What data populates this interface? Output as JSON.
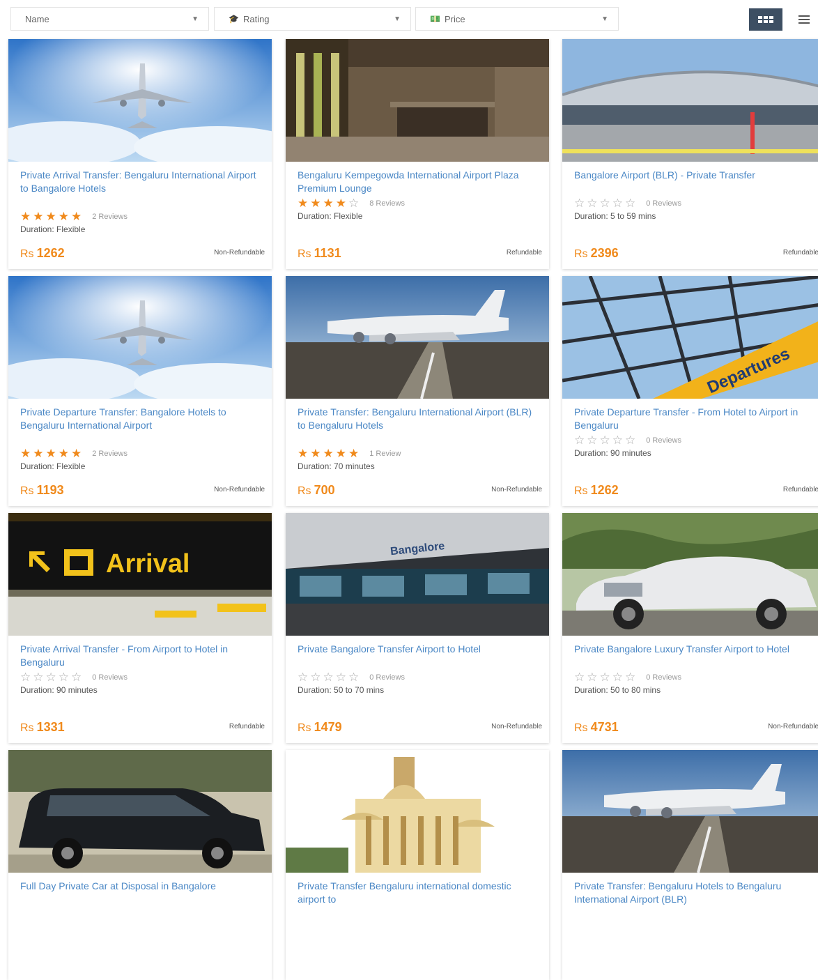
{
  "toolbar": {
    "sort_name": "Name",
    "sort_rating": "Rating",
    "sort_price": "Price"
  },
  "colors": {
    "accent": "#f08a1c",
    "title": "#4a87c5",
    "active_view": "#3d4f63"
  },
  "cards": [
    {
      "title": "Private Arrival Transfer: Bengaluru International Airport to Bangalore Hotels",
      "rating": 5,
      "reviews": "2 Reviews",
      "duration": "Duration: Flexible",
      "currency": "Rs",
      "price": "1262",
      "refund": "Non-Refundable",
      "image": "plane-in-sky"
    },
    {
      "title": "Bengaluru Kempegowda International Airport Plaza Premium Lounge",
      "rating": 4,
      "reviews": "8 Reviews",
      "duration": "Duration: Flexible",
      "currency": "Rs",
      "price": "1131",
      "refund": "Refundable",
      "image": "airport-lounge"
    },
    {
      "title": "Bangalore Airport (BLR) - Private Transfer",
      "rating": 0,
      "reviews": "0 Reviews",
      "duration": "Duration: 5 to 59 mins",
      "currency": "Rs",
      "price": "2396",
      "refund": "Refundable",
      "image": "airport-terminal"
    },
    {
      "title": "Private Departure Transfer: Bangalore Hotels to Bengaluru International Airport",
      "rating": 5,
      "reviews": "2 Reviews",
      "duration": "Duration: Flexible",
      "currency": "Rs",
      "price": "1193",
      "refund": "Non-Refundable",
      "image": "plane-in-sky"
    },
    {
      "title": "Private Transfer: Bengaluru International Airport (BLR) to Bengaluru Hotels",
      "rating": 5,
      "reviews": "1 Review",
      "duration": "Duration: 70 minutes",
      "currency": "Rs",
      "price": "700",
      "refund": "Non-Refundable",
      "image": "plane-landing"
    },
    {
      "title": "Private Departure Transfer - From Hotel to Airport in Bengaluru",
      "rating": 0,
      "reviews": "0 Reviews",
      "duration": "Duration: 90 minutes",
      "currency": "Rs",
      "price": "1262",
      "refund": "Refundable",
      "image": "departures-sign"
    },
    {
      "title": "Private Arrival Transfer - From Airport to Hotel in Bengaluru",
      "rating": 0,
      "reviews": "0 Reviews",
      "duration": "Duration: 90 minutes",
      "currency": "Rs",
      "price": "1331",
      "refund": "Refundable",
      "image": "arrival-sign"
    },
    {
      "title": "Private Bangalore Transfer Airport to Hotel",
      "rating": 0,
      "reviews": "0 Reviews",
      "duration": "Duration: 50 to 70 mins",
      "currency": "Rs",
      "price": "1479",
      "refund": "Non-Refundable",
      "image": "bangalore-terminal"
    },
    {
      "title": "Private Bangalore Luxury Transfer Airport to Hotel",
      "rating": 0,
      "reviews": "0 Reviews",
      "duration": "Duration: 50 to 80 mins",
      "currency": "Rs",
      "price": "4731",
      "refund": "Non-Refundable",
      "image": "luxury-car"
    },
    {
      "title": "Full Day Private Car at Disposal in Bangalore",
      "rating": 0,
      "reviews": "",
      "duration": "",
      "currency": "",
      "price": "",
      "refund": "",
      "image": "black-car"
    },
    {
      "title": "Private Transfer Bengaluru international domestic airport to",
      "rating": 0,
      "reviews": "",
      "duration": "",
      "currency": "",
      "price": "",
      "refund": "",
      "image": "palace"
    },
    {
      "title": "Private Transfer: Bengaluru Hotels to Bengaluru International Airport (BLR)",
      "rating": 0,
      "reviews": "",
      "duration": "",
      "currency": "",
      "price": "",
      "refund": "",
      "image": "plane-landing"
    }
  ],
  "sign_texts": {
    "arrival": "Arrival",
    "departures": "Departures",
    "bangalore": "Bangalore"
  }
}
